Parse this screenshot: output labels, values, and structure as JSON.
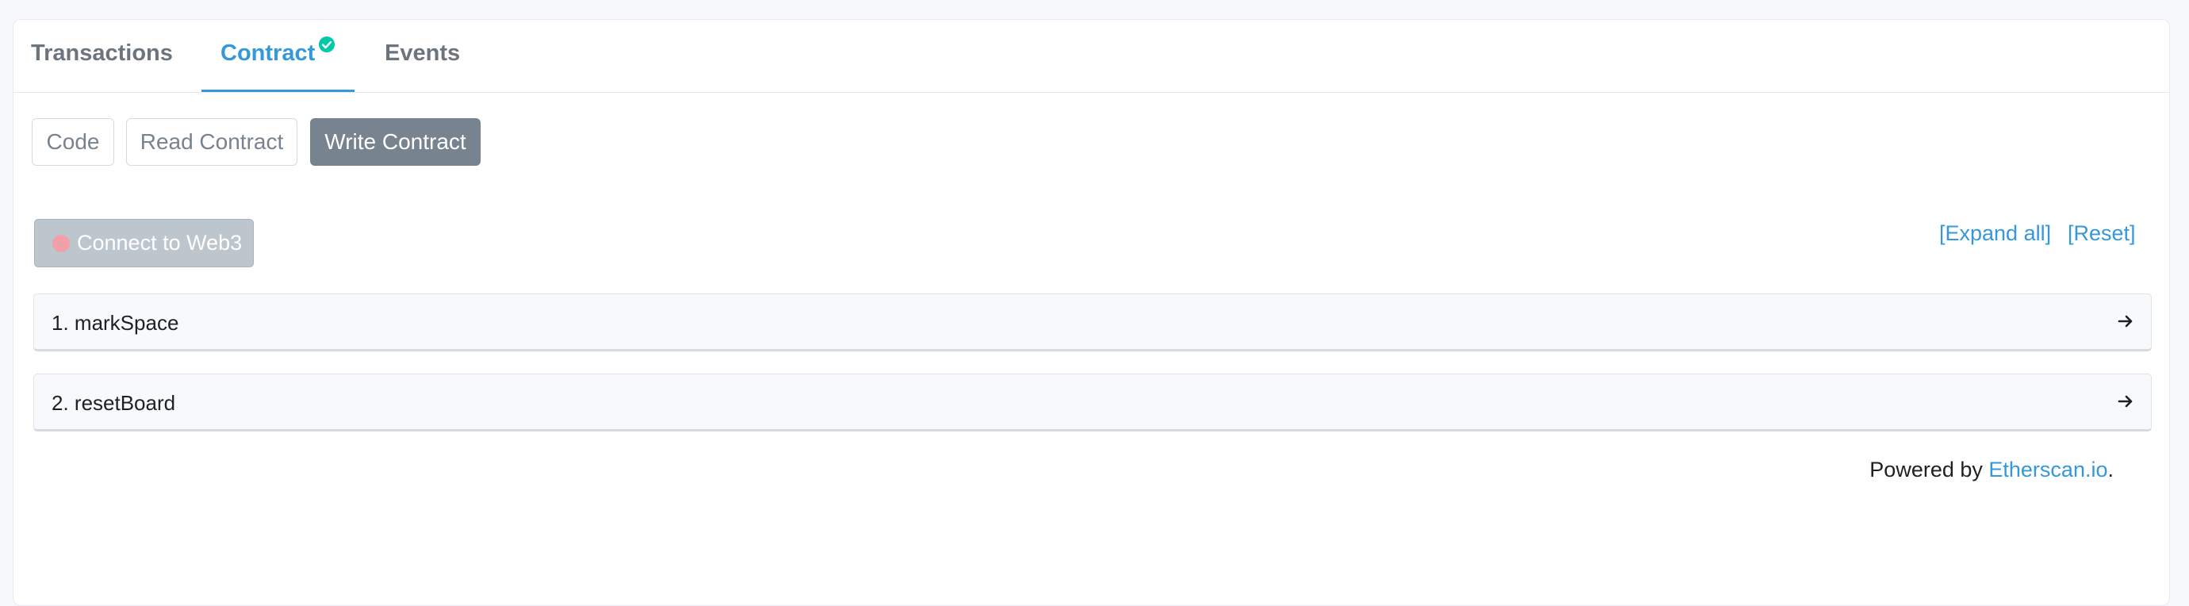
{
  "tabs": {
    "transactions": "Transactions",
    "contract": "Contract",
    "events": "Events"
  },
  "subtabs": {
    "code": "Code",
    "read": "Read Contract",
    "write": "Write Contract"
  },
  "connect": {
    "label": "Connect to Web3",
    "status_color": "#f1a0a8"
  },
  "actions": {
    "expand_all": "[Expand all]",
    "reset": "[Reset]"
  },
  "functions": [
    {
      "label": "1. markSpace"
    },
    {
      "label": "2. resetBoard"
    }
  ],
  "footer": {
    "prefix": "Powered by ",
    "link": "Etherscan.io",
    "suffix": "."
  },
  "colors": {
    "accent": "#3498db",
    "verified": "#00c9a7",
    "muted": "#77838f"
  },
  "icons": {
    "verified": "check-circle-icon",
    "row_arrow": "arrow-right-icon"
  }
}
